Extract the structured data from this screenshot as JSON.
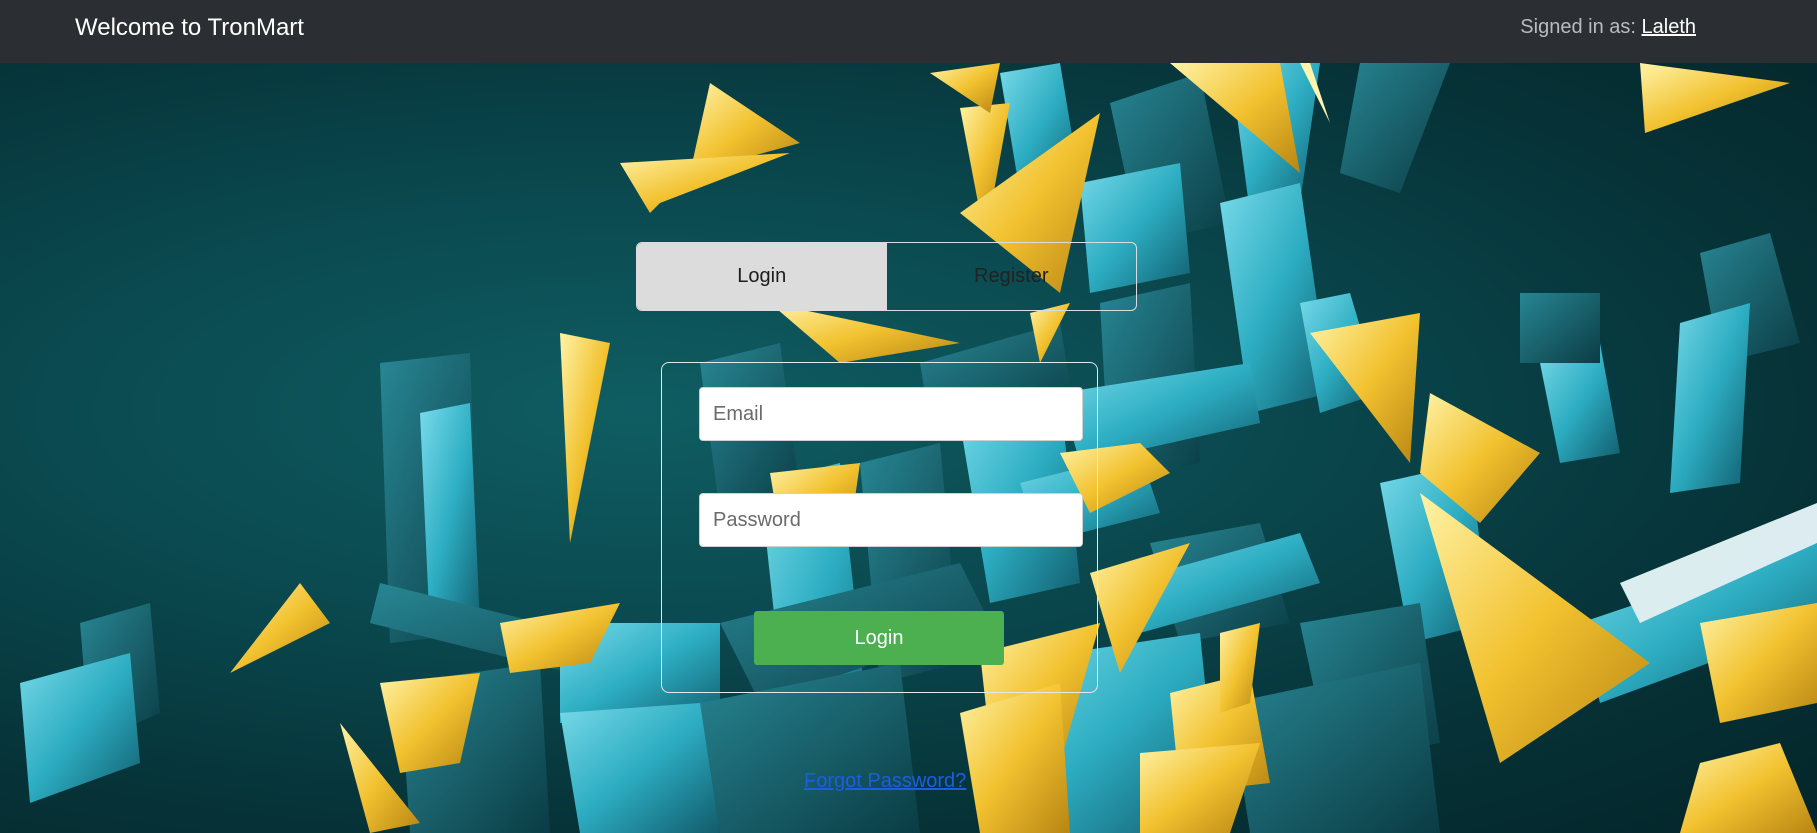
{
  "navbar": {
    "title": "Welcome to TronMart",
    "signed_in_label": "Signed in as:",
    "username": "Laleth"
  },
  "tabs": [
    {
      "label": "Login",
      "active": true
    },
    {
      "label": "Register",
      "active": false
    }
  ],
  "form": {
    "email_placeholder": "Email",
    "email_value": "",
    "password_placeholder": "Password",
    "password_value": "",
    "submit_label": "Login"
  },
  "forgot_password_label": "Forgot Password?",
  "colors": {
    "navbar_bg": "#2b2e32",
    "submit_bg": "#4caf50",
    "link": "#1a5fe0",
    "bg_teal": "#0a4a50",
    "shard_yellow": "#f2c230",
    "shard_cyan": "#2fb3c9"
  }
}
